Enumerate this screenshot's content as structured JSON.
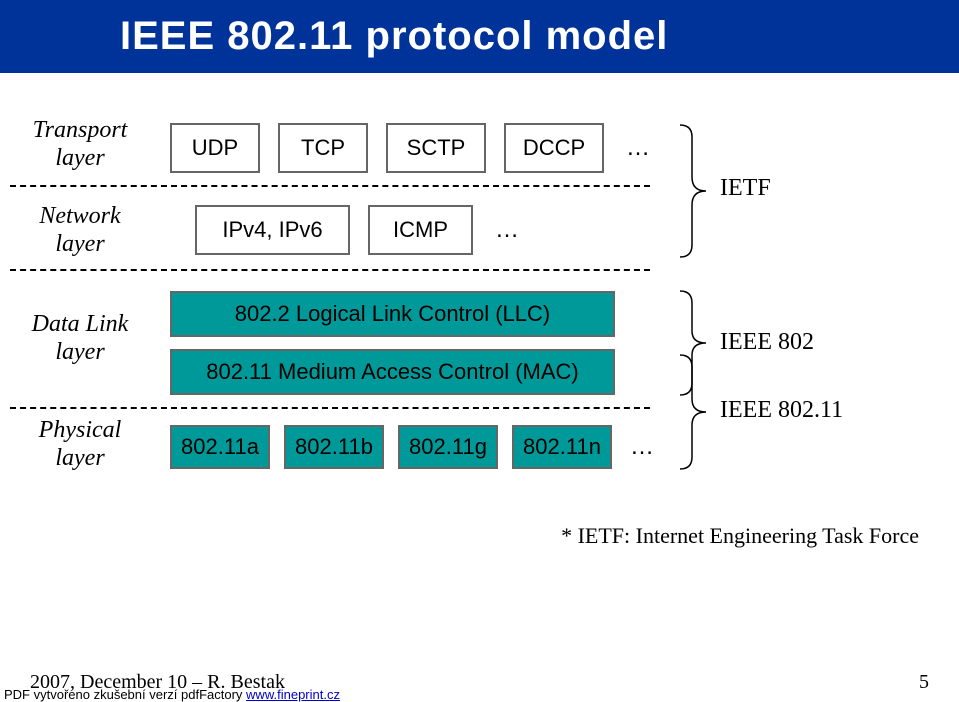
{
  "title": "IEEE 802.11 protocol model",
  "layers": {
    "transport": {
      "label_line1": "Transport",
      "label_line2": "layer"
    },
    "network": {
      "label_line1": "Network",
      "label_line2": "layer"
    },
    "datalink": {
      "label_line1": "Data Link",
      "label_line2": "layer"
    },
    "physical": {
      "label_line1": "Physical",
      "label_line2": "layer"
    }
  },
  "transport_row": {
    "boxes": [
      "UDP",
      "TCP",
      "SCTP",
      "DCCP"
    ],
    "more": "…"
  },
  "network_row": {
    "boxes": [
      "IPv4, IPv6",
      "ICMP"
    ],
    "more": "…"
  },
  "datalink_row": {
    "llc": "802.2 Logical Link Control (LLC)",
    "mac": "802.11 Medium Access Control (MAC)"
  },
  "physical_row": {
    "boxes": [
      "802.11a",
      "802.11b",
      "802.11g",
      "802.11n"
    ],
    "more": "…"
  },
  "brackets": {
    "ietf": "IETF",
    "ieee802": "IEEE 802",
    "ieee80211": "IEEE 802.11"
  },
  "footnote": "* IETF: Internet Engineering Task Force",
  "footer": {
    "left": "2007, December 10 – R. Bestak",
    "right": "5"
  },
  "pdf_line": {
    "prefix": "PDF vytvořeno zkušební verzí pdfFactory ",
    "link": "www.fineprint.cz"
  }
}
